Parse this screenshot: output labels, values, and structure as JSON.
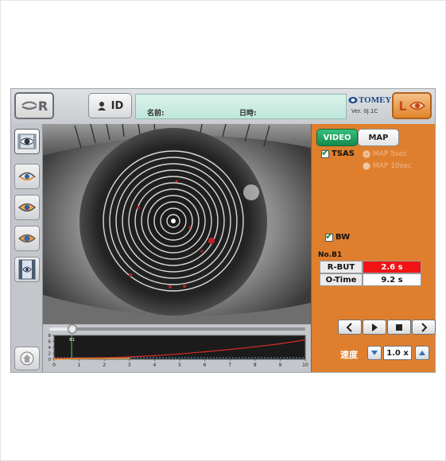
{
  "topbar": {
    "right_eye_label": "R",
    "left_eye_label": "L",
    "id_label": "ID",
    "name_label": "名前:",
    "date_label": "日時:",
    "brand": "TOMEY",
    "version": "Ver.  0J.1C"
  },
  "sidebar": {
    "items": [
      {
        "icon": "video-eye-icon",
        "selected": true
      },
      {
        "icon": "eye-icon",
        "selected": false
      },
      {
        "icon": "eye-filled-icon",
        "selected": false
      },
      {
        "icon": "eye-blue-icon",
        "selected": false
      },
      {
        "icon": "film-eye-icon",
        "selected": false
      }
    ],
    "home_icon": "home-icon"
  },
  "panel": {
    "tabs": [
      {
        "label": "VIDEO",
        "active": true
      },
      {
        "label": "MAP",
        "active": false
      }
    ],
    "tsas_label": "TSAS",
    "tsas_checked": true,
    "map_options": [
      {
        "label": "MAP 5sec",
        "selected": true
      },
      {
        "label": "MAP 10sec",
        "selected": false
      }
    ],
    "bw_label": "BW",
    "bw_checked": true,
    "number_label": "No.B1",
    "results": [
      {
        "label": "R-BUT",
        "value": "2.6 s",
        "highlight": "#f01414"
      },
      {
        "label": "O-Time",
        "value": "9.2 s",
        "highlight": "#ffffff"
      }
    ],
    "speed_label": "速度",
    "speed_value": "1.0 x"
  },
  "timeline": {
    "position": 0.09,
    "marker_label": "B1"
  },
  "chart_data": {
    "type": "line",
    "x": [
      0,
      1,
      2,
      3,
      4,
      5,
      6,
      7,
      8,
      9,
      10
    ],
    "xticks": [
      "0",
      "1",
      "2",
      "3",
      "4",
      "5",
      "6",
      "7",
      "8",
      "9",
      "10"
    ],
    "yticks": [
      "0",
      "2",
      "4",
      "6",
      "8"
    ],
    "ylim": [
      0,
      8
    ],
    "xlim": [
      0,
      10
    ],
    "series": [
      {
        "color": "#d62a2a",
        "values": [
          0.3,
          0.4,
          0.5,
          0.8,
          1.2,
          1.8,
          2.5,
          3.3,
          4.2,
          5.2,
          6.5
        ]
      },
      {
        "color": "#e3a12b",
        "values": [
          0.0,
          0.2,
          0.3,
          0.3,
          null,
          null,
          null,
          null,
          null,
          null,
          null
        ]
      }
    ],
    "marker_x": 0.7
  },
  "colors": {
    "panel": "#df7f2e",
    "accent_green": "#168a4e",
    "alert_red": "#f01414"
  }
}
